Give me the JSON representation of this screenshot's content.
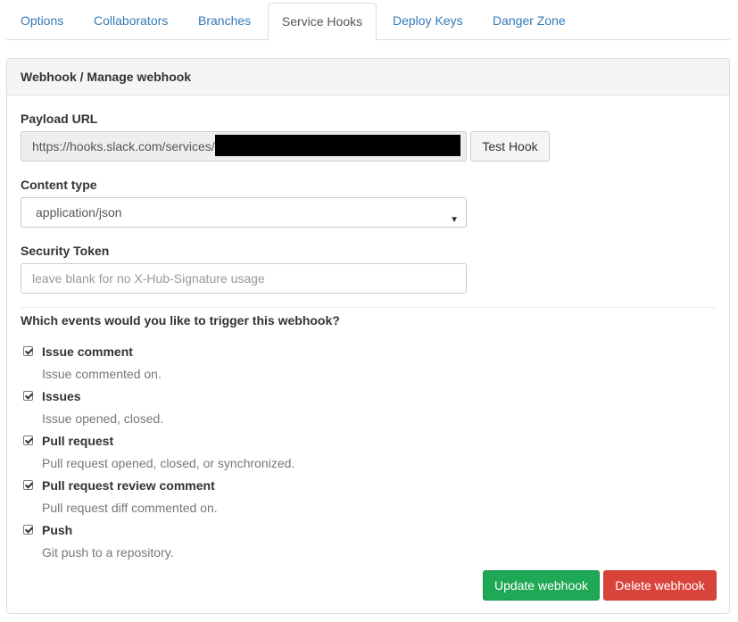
{
  "tabs": [
    {
      "label": "Options"
    },
    {
      "label": "Collaborators"
    },
    {
      "label": "Branches"
    },
    {
      "label": "Service Hooks",
      "active": true
    },
    {
      "label": "Deploy Keys"
    },
    {
      "label": "Danger Zone"
    }
  ],
  "panel": {
    "title": "Webhook / Manage webhook"
  },
  "form": {
    "payload_url": {
      "label": "Payload URL",
      "value": "https://hooks.slack.com/services/T",
      "test_button": "Test Hook"
    },
    "content_type": {
      "label": "Content type",
      "value": "application/json"
    },
    "security_token": {
      "label": "Security Token",
      "placeholder": "leave blank for no X-Hub-Signature usage"
    },
    "events_question": "Which events would you like to trigger this webhook?",
    "events": [
      {
        "name": "Issue comment",
        "description": "Issue commented on.",
        "checked": true
      },
      {
        "name": "Issues",
        "description": "Issue opened, closed.",
        "checked": true
      },
      {
        "name": "Pull request",
        "description": "Pull request opened, closed, or synchronized.",
        "checked": true
      },
      {
        "name": "Pull request review comment",
        "description": "Pull request diff commented on.",
        "checked": true
      },
      {
        "name": "Push",
        "description": "Git push to a repository.",
        "checked": true
      }
    ]
  },
  "actions": {
    "update": "Update webhook",
    "delete": "Delete webhook"
  },
  "colors": {
    "link": "#337ab7",
    "success": "#1fa855",
    "danger": "#d9443a"
  }
}
